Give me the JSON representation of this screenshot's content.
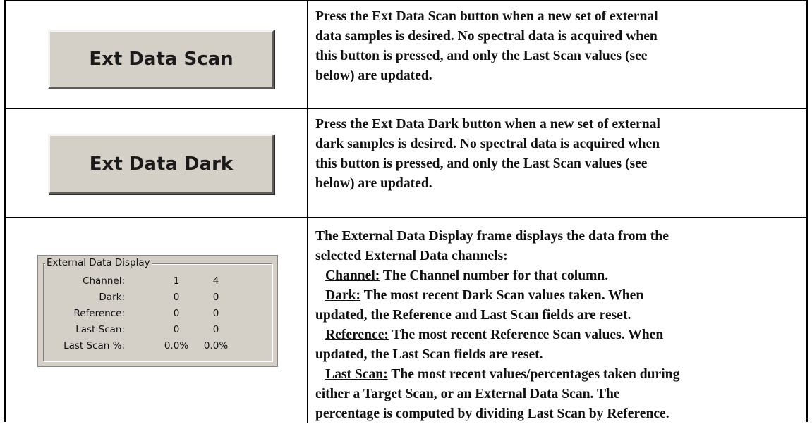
{
  "rows": [
    {
      "button_label": "Ext Data Scan",
      "description": [
        "Press the Ext Data Scan button when a new set of external",
        "data samples is desired. No spectral data is acquired when",
        "this button is pressed, and only the Last Scan values (see",
        "below) are updated."
      ]
    },
    {
      "button_label": "Ext Data Dark",
      "description": [
        "Press the Ext Data Dark button when a new set of external",
        "dark samples is desired. No spectral data is acquired when",
        "this button is pressed, and only the Last Scan values (see",
        "below) are updated."
      ]
    }
  ],
  "external_data_display": {
    "title": "External Data Display",
    "rows": [
      {
        "label": "Channel:",
        "values": [
          "1",
          "4"
        ]
      },
      {
        "label": "Dark:",
        "values": [
          "0",
          "0"
        ]
      },
      {
        "label": "Reference:",
        "values": [
          "0",
          "0"
        ]
      },
      {
        "label": "Last Scan:",
        "values": [
          "0",
          "0"
        ]
      },
      {
        "label": "Last Scan %:",
        "values": [
          "0.0%",
          "0.0%"
        ]
      }
    ]
  },
  "display_description": {
    "intro": [
      "The External Data Display frame displays the data from the",
      "selected External Data channels:"
    ],
    "items": [
      {
        "term": "Channel:",
        "text": [
          " The Channel number for that column."
        ]
      },
      {
        "term": "Dark:",
        "text": [
          " The most recent Dark Scan values taken. When",
          "updated, the Reference and Last Scan fields are reset."
        ]
      },
      {
        "term": "Reference:",
        "text": [
          " The most recent Reference Scan values. When",
          "updated, the Last Scan fields are reset."
        ]
      },
      {
        "term": "Last Scan:",
        "text": [
          " The most recent values/percentages taken during",
          "either a Target Scan, or an External Data Scan. The",
          "percentage is computed by dividing Last Scan by Reference."
        ]
      }
    ]
  },
  "colors": {
    "button_face": "#d4d0c8",
    "border": "#000000",
    "text": "#111111"
  }
}
